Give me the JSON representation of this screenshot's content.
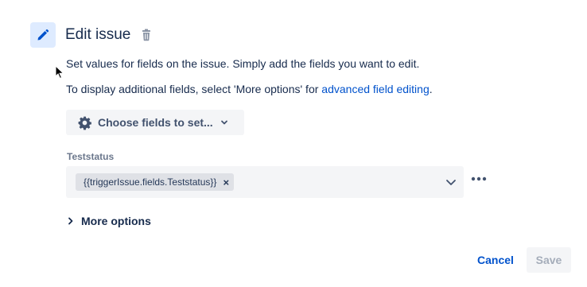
{
  "header": {
    "title": "Edit issue",
    "icon": "pencil-icon",
    "delete_icon": "trash-icon"
  },
  "description": {
    "line1": "Set values for fields on the issue. Simply add the fields you want to edit.",
    "line2_prefix": "To display additional fields, select 'More options' for ",
    "line2_link": "advanced field editing",
    "line2_suffix": "."
  },
  "choose_fields": {
    "label": "Choose fields to set...",
    "icon": "gear-icon"
  },
  "field": {
    "label": "Teststatus",
    "tag_value": "{{triggerIssue.fields.Teststatus}}",
    "tag_remove": "×"
  },
  "more_options": {
    "label": "More options"
  },
  "footer": {
    "cancel_label": "Cancel",
    "save_label": "Save"
  },
  "colors": {
    "accent": "#0052cc",
    "text": "#172b4d",
    "icon_bg": "#deebff",
    "field_bg": "#f4f5f7",
    "disabled_text": "#a5adba"
  }
}
